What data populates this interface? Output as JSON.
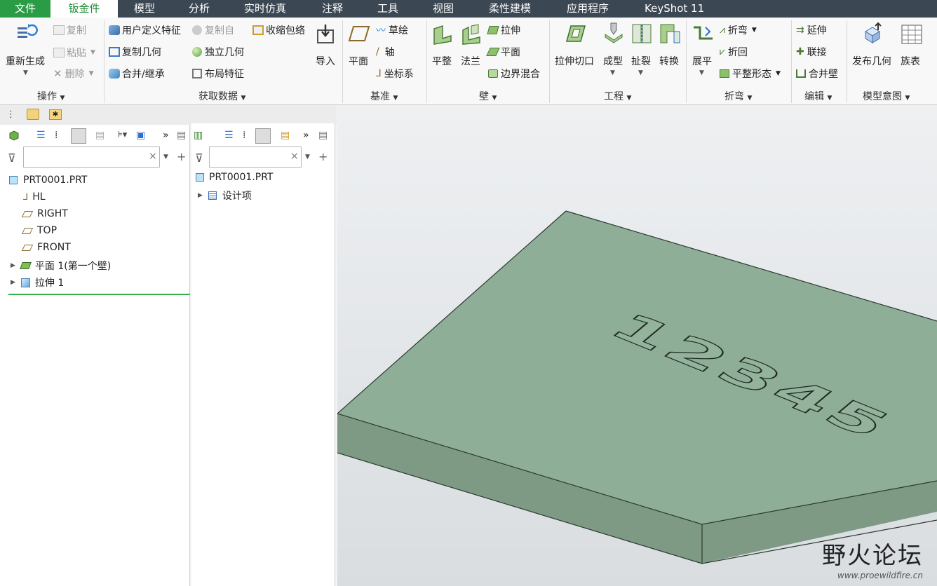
{
  "menu": {
    "tabs": [
      "文件",
      "钣金件",
      "模型",
      "分析",
      "实时仿真",
      "注释",
      "工具",
      "视图",
      "柔性建模",
      "应用程序",
      "KeyShot 11"
    ],
    "active_index": 1
  },
  "ribbon": {
    "operations": {
      "label": "操作",
      "regenerate": "重新生成",
      "copy": "复制",
      "paste": "粘贴",
      "delete": "删除"
    },
    "get_data": {
      "label": "获取数据",
      "udf": "用户定义特征",
      "copy_from": "复制自",
      "shrinkwrap": "收缩包络",
      "copy_geom": "复制几何",
      "independent_geom": "独立几何",
      "merge_inherit": "合并/继承",
      "layout_feature": "布局特征",
      "import": "导入"
    },
    "datum": {
      "label": "基准",
      "plane": "平面",
      "sketch": "草绘",
      "axis": "轴",
      "csys": "坐标系"
    },
    "wall": {
      "label": "壁",
      "flat": "平整",
      "flange": "法兰",
      "extrude": "拉伸",
      "planar": "平面",
      "boundary_blend": "边界混合"
    },
    "engineering": {
      "label": "工程",
      "extrude_cut": "拉伸切口",
      "form": "成型",
      "rip": "扯裂",
      "convert": "转换"
    },
    "bend": {
      "label": "折弯",
      "unbend": "展平",
      "bend": "折弯",
      "bend_back": "折回",
      "flat_state": "平整形态"
    },
    "edit": {
      "label": "编辑",
      "extend": "延伸",
      "join": "联接",
      "merge_walls": "合并壁"
    },
    "model_intent": {
      "label": "模型意图",
      "publish_geom": "发布几何",
      "family_table": "族表"
    }
  },
  "model_tree": {
    "root": "PRT0001.PRT",
    "items": [
      "HL",
      "RIGHT",
      "TOP",
      "FRONT",
      "平面 1(第一个壁)",
      "拉伸 1"
    ],
    "search_value": ""
  },
  "detail_tree": {
    "root": "PRT0001.PRT",
    "items": [
      "设计项"
    ],
    "search_value": ""
  },
  "viewport": {
    "engraved_text": "12345",
    "plate_color": "#8fae98"
  },
  "watermark": {
    "title": "野火论坛",
    "url": "www.proewildfire.cn"
  },
  "colors": {
    "accent": "#1e8c37",
    "menubar": "#3b4753"
  }
}
